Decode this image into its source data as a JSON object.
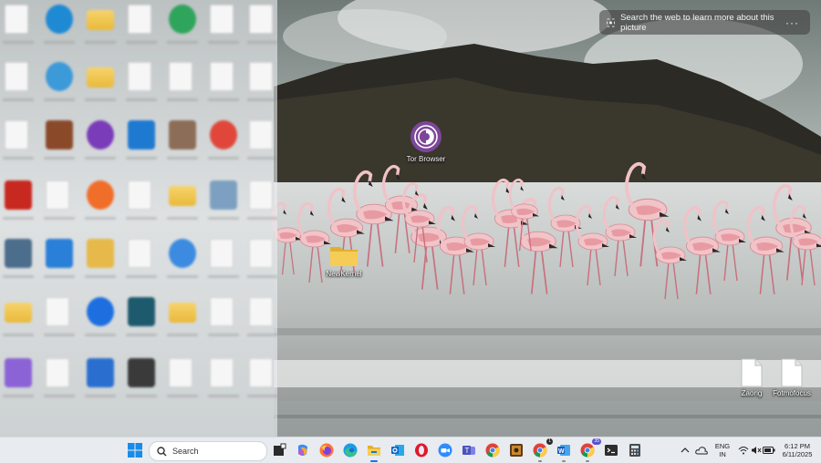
{
  "lens_bar": {
    "text": "Search the web to learn more about this picture",
    "more": "···"
  },
  "desktop_icons": [
    {
      "name": "Tor Browser"
    },
    {
      "name": "NewKernel"
    },
    {
      "name": "Zaorig"
    },
    {
      "name": "Fotmofocus"
    }
  ],
  "taskbar": {
    "search_placeholder": "Search",
    "pinned": [
      "widgets-icon",
      "copilot-icon",
      "firefox-icon",
      "edge-icon",
      "file-explorer-icon",
      "outlook-icon",
      "opera-icon",
      "zoom-icon",
      "teams-icon",
      "chrome-icon",
      "media-icon",
      "chrome-profile-icon",
      "word-icon",
      "chrome-profile-icon",
      "terminal-icon",
      "calculator-icon"
    ],
    "badges": {
      "chrome_profile_1": "1",
      "chrome_profile_2": "35"
    },
    "language_line1": "ENG",
    "language_line2": "IN",
    "time": "6:12 PM",
    "date": "6/11/2025"
  },
  "colors": {
    "taskbar": "#e8ebf0",
    "tor_purple": "#7d4698",
    "folder_yellow": "#f0c443"
  }
}
